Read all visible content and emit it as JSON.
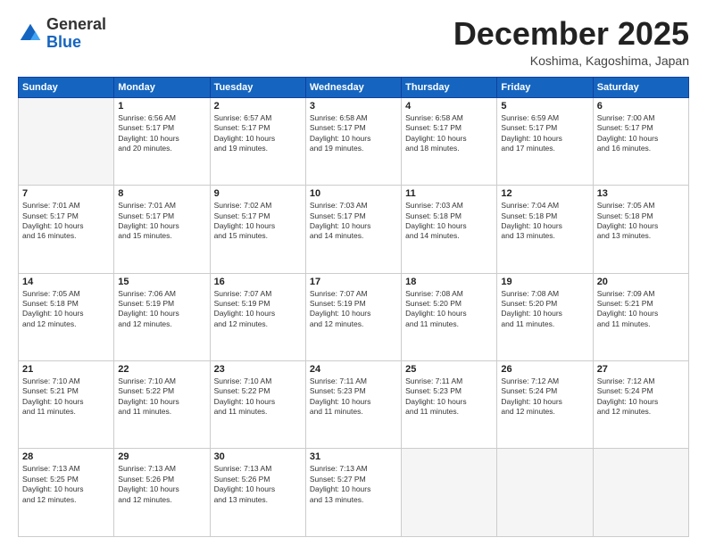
{
  "header": {
    "logo": {
      "general": "General",
      "blue": "Blue"
    },
    "title": "December 2025",
    "location": "Koshima, Kagoshima, Japan"
  },
  "calendar": {
    "days_of_week": [
      "Sunday",
      "Monday",
      "Tuesday",
      "Wednesday",
      "Thursday",
      "Friday",
      "Saturday"
    ],
    "weeks": [
      [
        {
          "day": "",
          "info": ""
        },
        {
          "day": "1",
          "info": "Sunrise: 6:56 AM\nSunset: 5:17 PM\nDaylight: 10 hours\nand 20 minutes."
        },
        {
          "day": "2",
          "info": "Sunrise: 6:57 AM\nSunset: 5:17 PM\nDaylight: 10 hours\nand 19 minutes."
        },
        {
          "day": "3",
          "info": "Sunrise: 6:58 AM\nSunset: 5:17 PM\nDaylight: 10 hours\nand 19 minutes."
        },
        {
          "day": "4",
          "info": "Sunrise: 6:58 AM\nSunset: 5:17 PM\nDaylight: 10 hours\nand 18 minutes."
        },
        {
          "day": "5",
          "info": "Sunrise: 6:59 AM\nSunset: 5:17 PM\nDaylight: 10 hours\nand 17 minutes."
        },
        {
          "day": "6",
          "info": "Sunrise: 7:00 AM\nSunset: 5:17 PM\nDaylight: 10 hours\nand 16 minutes."
        }
      ],
      [
        {
          "day": "7",
          "info": "Sunrise: 7:01 AM\nSunset: 5:17 PM\nDaylight: 10 hours\nand 16 minutes."
        },
        {
          "day": "8",
          "info": "Sunrise: 7:01 AM\nSunset: 5:17 PM\nDaylight: 10 hours\nand 15 minutes."
        },
        {
          "day": "9",
          "info": "Sunrise: 7:02 AM\nSunset: 5:17 PM\nDaylight: 10 hours\nand 15 minutes."
        },
        {
          "day": "10",
          "info": "Sunrise: 7:03 AM\nSunset: 5:17 PM\nDaylight: 10 hours\nand 14 minutes."
        },
        {
          "day": "11",
          "info": "Sunrise: 7:03 AM\nSunset: 5:18 PM\nDaylight: 10 hours\nand 14 minutes."
        },
        {
          "day": "12",
          "info": "Sunrise: 7:04 AM\nSunset: 5:18 PM\nDaylight: 10 hours\nand 13 minutes."
        },
        {
          "day": "13",
          "info": "Sunrise: 7:05 AM\nSunset: 5:18 PM\nDaylight: 10 hours\nand 13 minutes."
        }
      ],
      [
        {
          "day": "14",
          "info": "Sunrise: 7:05 AM\nSunset: 5:18 PM\nDaylight: 10 hours\nand 12 minutes."
        },
        {
          "day": "15",
          "info": "Sunrise: 7:06 AM\nSunset: 5:19 PM\nDaylight: 10 hours\nand 12 minutes."
        },
        {
          "day": "16",
          "info": "Sunrise: 7:07 AM\nSunset: 5:19 PM\nDaylight: 10 hours\nand 12 minutes."
        },
        {
          "day": "17",
          "info": "Sunrise: 7:07 AM\nSunset: 5:19 PM\nDaylight: 10 hours\nand 12 minutes."
        },
        {
          "day": "18",
          "info": "Sunrise: 7:08 AM\nSunset: 5:20 PM\nDaylight: 10 hours\nand 11 minutes."
        },
        {
          "day": "19",
          "info": "Sunrise: 7:08 AM\nSunset: 5:20 PM\nDaylight: 10 hours\nand 11 minutes."
        },
        {
          "day": "20",
          "info": "Sunrise: 7:09 AM\nSunset: 5:21 PM\nDaylight: 10 hours\nand 11 minutes."
        }
      ],
      [
        {
          "day": "21",
          "info": "Sunrise: 7:10 AM\nSunset: 5:21 PM\nDaylight: 10 hours\nand 11 minutes."
        },
        {
          "day": "22",
          "info": "Sunrise: 7:10 AM\nSunset: 5:22 PM\nDaylight: 10 hours\nand 11 minutes."
        },
        {
          "day": "23",
          "info": "Sunrise: 7:10 AM\nSunset: 5:22 PM\nDaylight: 10 hours\nand 11 minutes."
        },
        {
          "day": "24",
          "info": "Sunrise: 7:11 AM\nSunset: 5:23 PM\nDaylight: 10 hours\nand 11 minutes."
        },
        {
          "day": "25",
          "info": "Sunrise: 7:11 AM\nSunset: 5:23 PM\nDaylight: 10 hours\nand 11 minutes."
        },
        {
          "day": "26",
          "info": "Sunrise: 7:12 AM\nSunset: 5:24 PM\nDaylight: 10 hours\nand 12 minutes."
        },
        {
          "day": "27",
          "info": "Sunrise: 7:12 AM\nSunset: 5:24 PM\nDaylight: 10 hours\nand 12 minutes."
        }
      ],
      [
        {
          "day": "28",
          "info": "Sunrise: 7:13 AM\nSunset: 5:25 PM\nDaylight: 10 hours\nand 12 minutes."
        },
        {
          "day": "29",
          "info": "Sunrise: 7:13 AM\nSunset: 5:26 PM\nDaylight: 10 hours\nand 12 minutes."
        },
        {
          "day": "30",
          "info": "Sunrise: 7:13 AM\nSunset: 5:26 PM\nDaylight: 10 hours\nand 13 minutes."
        },
        {
          "day": "31",
          "info": "Sunrise: 7:13 AM\nSunset: 5:27 PM\nDaylight: 10 hours\nand 13 minutes."
        },
        {
          "day": "",
          "info": ""
        },
        {
          "day": "",
          "info": ""
        },
        {
          "day": "",
          "info": ""
        }
      ]
    ]
  }
}
